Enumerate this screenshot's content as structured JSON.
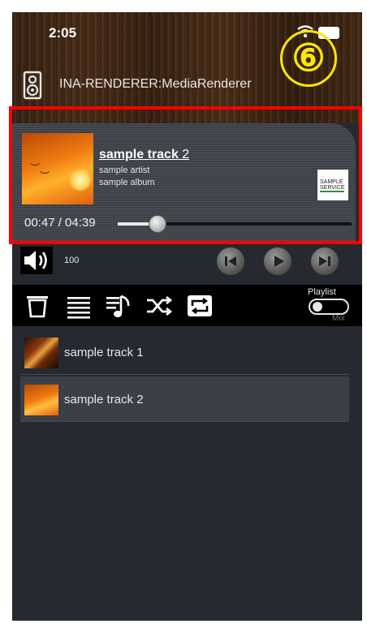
{
  "status_bar": {
    "time": "2:05"
  },
  "annotation_marker": "⑥",
  "renderer": {
    "label": "INA-RENDERER:MediaRenderer"
  },
  "now_playing": {
    "title_main": "sample track",
    "title_num": " 2",
    "artist": "sample artist",
    "album": "sample album",
    "service_logo_text": "SAMPLE SERVICE",
    "time_label": "00:47 / 04:39",
    "progress_fraction": 0.168
  },
  "controls": {
    "volume": "100"
  },
  "toolbar": {
    "playlist_label": "Playlist",
    "mix_label": "Mix"
  },
  "playlist": [
    {
      "label": "sample track 1",
      "selected": false
    },
    {
      "label": "sample track 2",
      "selected": true
    }
  ],
  "colors": {
    "highlight": "#ff0000",
    "marker": "#ffe600"
  }
}
